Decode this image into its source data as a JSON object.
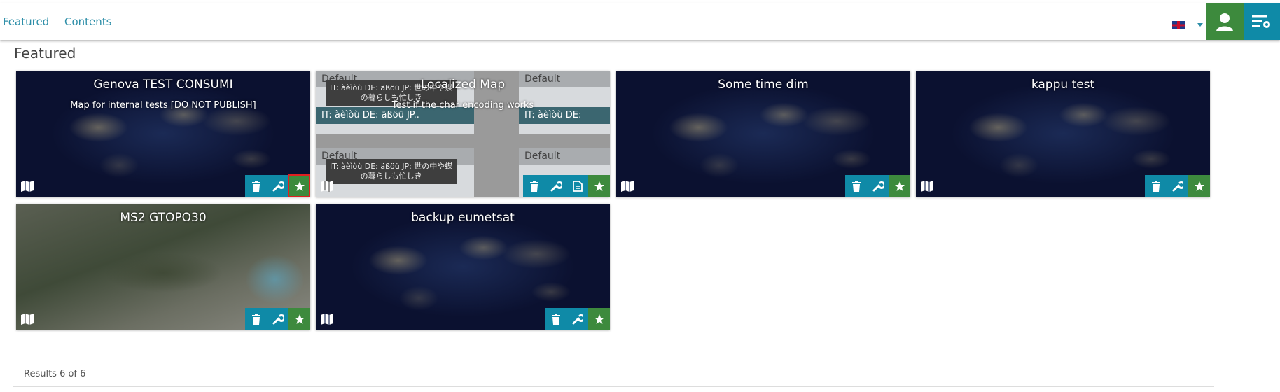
{
  "nav": {
    "featured": "Featured",
    "contents": "Contents"
  },
  "header": {
    "language_flag": "uk-flag-icon"
  },
  "section": {
    "title": "Featured"
  },
  "cards": [
    {
      "title": "Genova TEST CONSUMI",
      "description": "Map for internal tests [DO NOT PUBLISH]"
    },
    {
      "title": "Localized Map",
      "description": "Test if the char encoding works"
    },
    {
      "title": "Some time dim",
      "description": ""
    },
    {
      "title": "kappu test",
      "description": ""
    },
    {
      "title": "MS2 GTOPO30",
      "description": ""
    },
    {
      "title": "backup eumetsat",
      "description": ""
    }
  ],
  "localized_preview": {
    "header": "Default",
    "tooltip_line1": "IT: àèìòù DE: äßöü JP: 世の中や蝶",
    "tooltip_line2": "の暮らしも忙しき",
    "row": "IT: àèìòù DE: äßöü JP..",
    "row_short": "IT: àèìòù DE:"
  },
  "results": "Results 6 of 6",
  "colors": {
    "accent_blue": "#0f8aa7",
    "accent_green": "#3d8a3d",
    "link": "#2d8ea8"
  }
}
